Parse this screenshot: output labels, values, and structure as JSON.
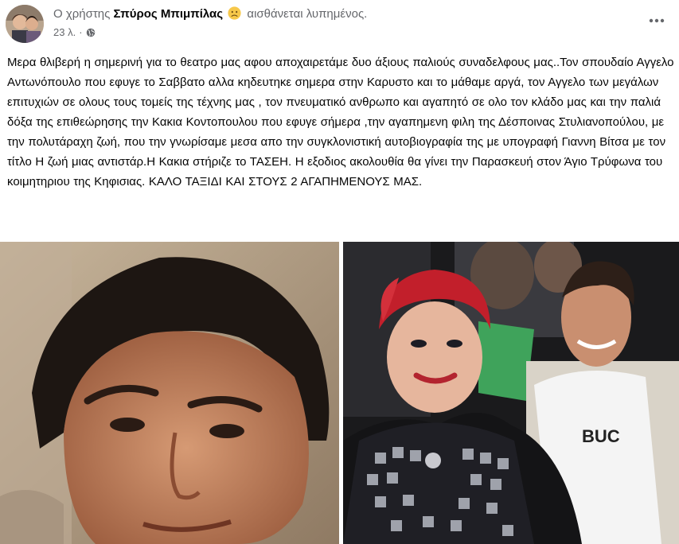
{
  "post": {
    "header": {
      "prefix": "Ο χρήστης ",
      "author": "Σπύρος Μπιμπίλας",
      "feeling": " αισθάνεται λυπημένος.",
      "feeling_icon": "sad-face-emoji"
    },
    "meta": {
      "time": "23 λ.",
      "separator": "·",
      "privacy_icon": "globe-icon"
    },
    "more_icon": "more-options-icon",
    "text": "Μερα θλιβερή η σημερινή για το θεατρο μας αφου αποχαιρετάμε δυο άξιους παλιούς συναδελφους μας..Τον σπουδαίο Αγγελο Αντωνόπουλο που εφυγε το Σαββατο αλλα κηδευτηκε σημερα στην Καρυστο και το μάθαμε αργά, τον Αγγελο των μεγάλων επιτυχιών σε ολους τους τομείς της τέχνης μας , τον πνευματικό ανθρωπο και αγαπητό σε ολο τον κλάδο μας και την παλιά δόξα της επιθεώρησης την Κακια Κοντοπουλου που εφυγε σήμερα ,την αγαπημενη φιλη της Δέσποινας Στυλιανοπούλου, με την πολυτάραχη ζωή, που την γνωρίσαμε μεσα απο την συγκλονιστική αυτοβιογραφία της με υπογραφή Γιαννη Βίτσα με τον τίτλο Η ζωή μιας αντιστάρ.Η Κακια στήριζε το ΤΑΣΕΗ. Η εξοδιος ακολουθία θα γίνει την Παρασκευή στον Άγιο Τρύφωνα του κοιμητηριου της Κηφισιας. ΚΑΛΟ ΤΑΞΙΔΙ ΚΑΙ ΣΤΟΥΣ 2 ΑΓΑΠΗΜΕΝΟΥΣ ΜΑΣ.",
    "photos": [
      {
        "name": "photo-left",
        "shirt_text": ""
      },
      {
        "name": "photo-right",
        "shirt_text": "BUC"
      }
    ]
  },
  "colors": {
    "text": "#050505",
    "muted": "#65676b",
    "background": "#ffffff"
  }
}
